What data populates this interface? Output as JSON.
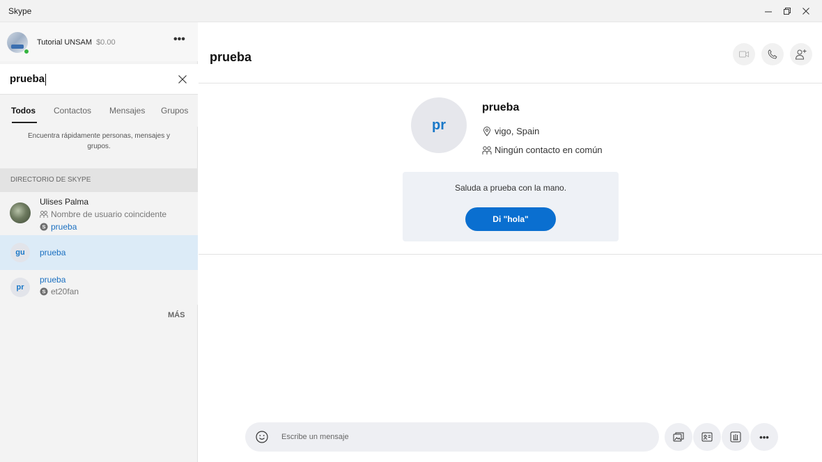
{
  "window": {
    "title": "Skype"
  },
  "profile": {
    "name": "Tutorial UNSAM",
    "credit": "$0.00",
    "more": "•••"
  },
  "search": {
    "query": "prueba"
  },
  "filters": [
    {
      "label": "Todos",
      "active": true
    },
    {
      "label": "Contactos",
      "active": false
    },
    {
      "label": "Mensajes",
      "active": false
    },
    {
      "label": "Grupos",
      "active": false
    }
  ],
  "hint": "Encuentra rápidamente personas, mensajes y grupos.",
  "directory_header": "DIRECTORIO DE SKYPE",
  "results": [
    {
      "name": "Ulises Palma",
      "match": "Nombre de usuario coincidente",
      "username": "prueba"
    },
    {
      "initials": "gu",
      "name": "prueba"
    },
    {
      "initials": "pr",
      "name": "prueba",
      "username": "et20fan"
    }
  ],
  "more_link": "MÁS",
  "conversation": {
    "title": "prueba",
    "avatar_initials": "pr",
    "name": "prueba",
    "location": "vigo, Spain",
    "common_contacts": "Ningún contacto en común",
    "wave_prompt": "Saluda a prueba con la mano.",
    "wave_button": "Di \"hola\""
  },
  "composer": {
    "placeholder": "Escribe un mensaje",
    "more": "•••"
  },
  "colors": {
    "accent": "#0a6fd0",
    "selected_row": "#dcebf7",
    "sidebar_bg": "#f3f3f3",
    "presence_online": "#34b43f"
  }
}
